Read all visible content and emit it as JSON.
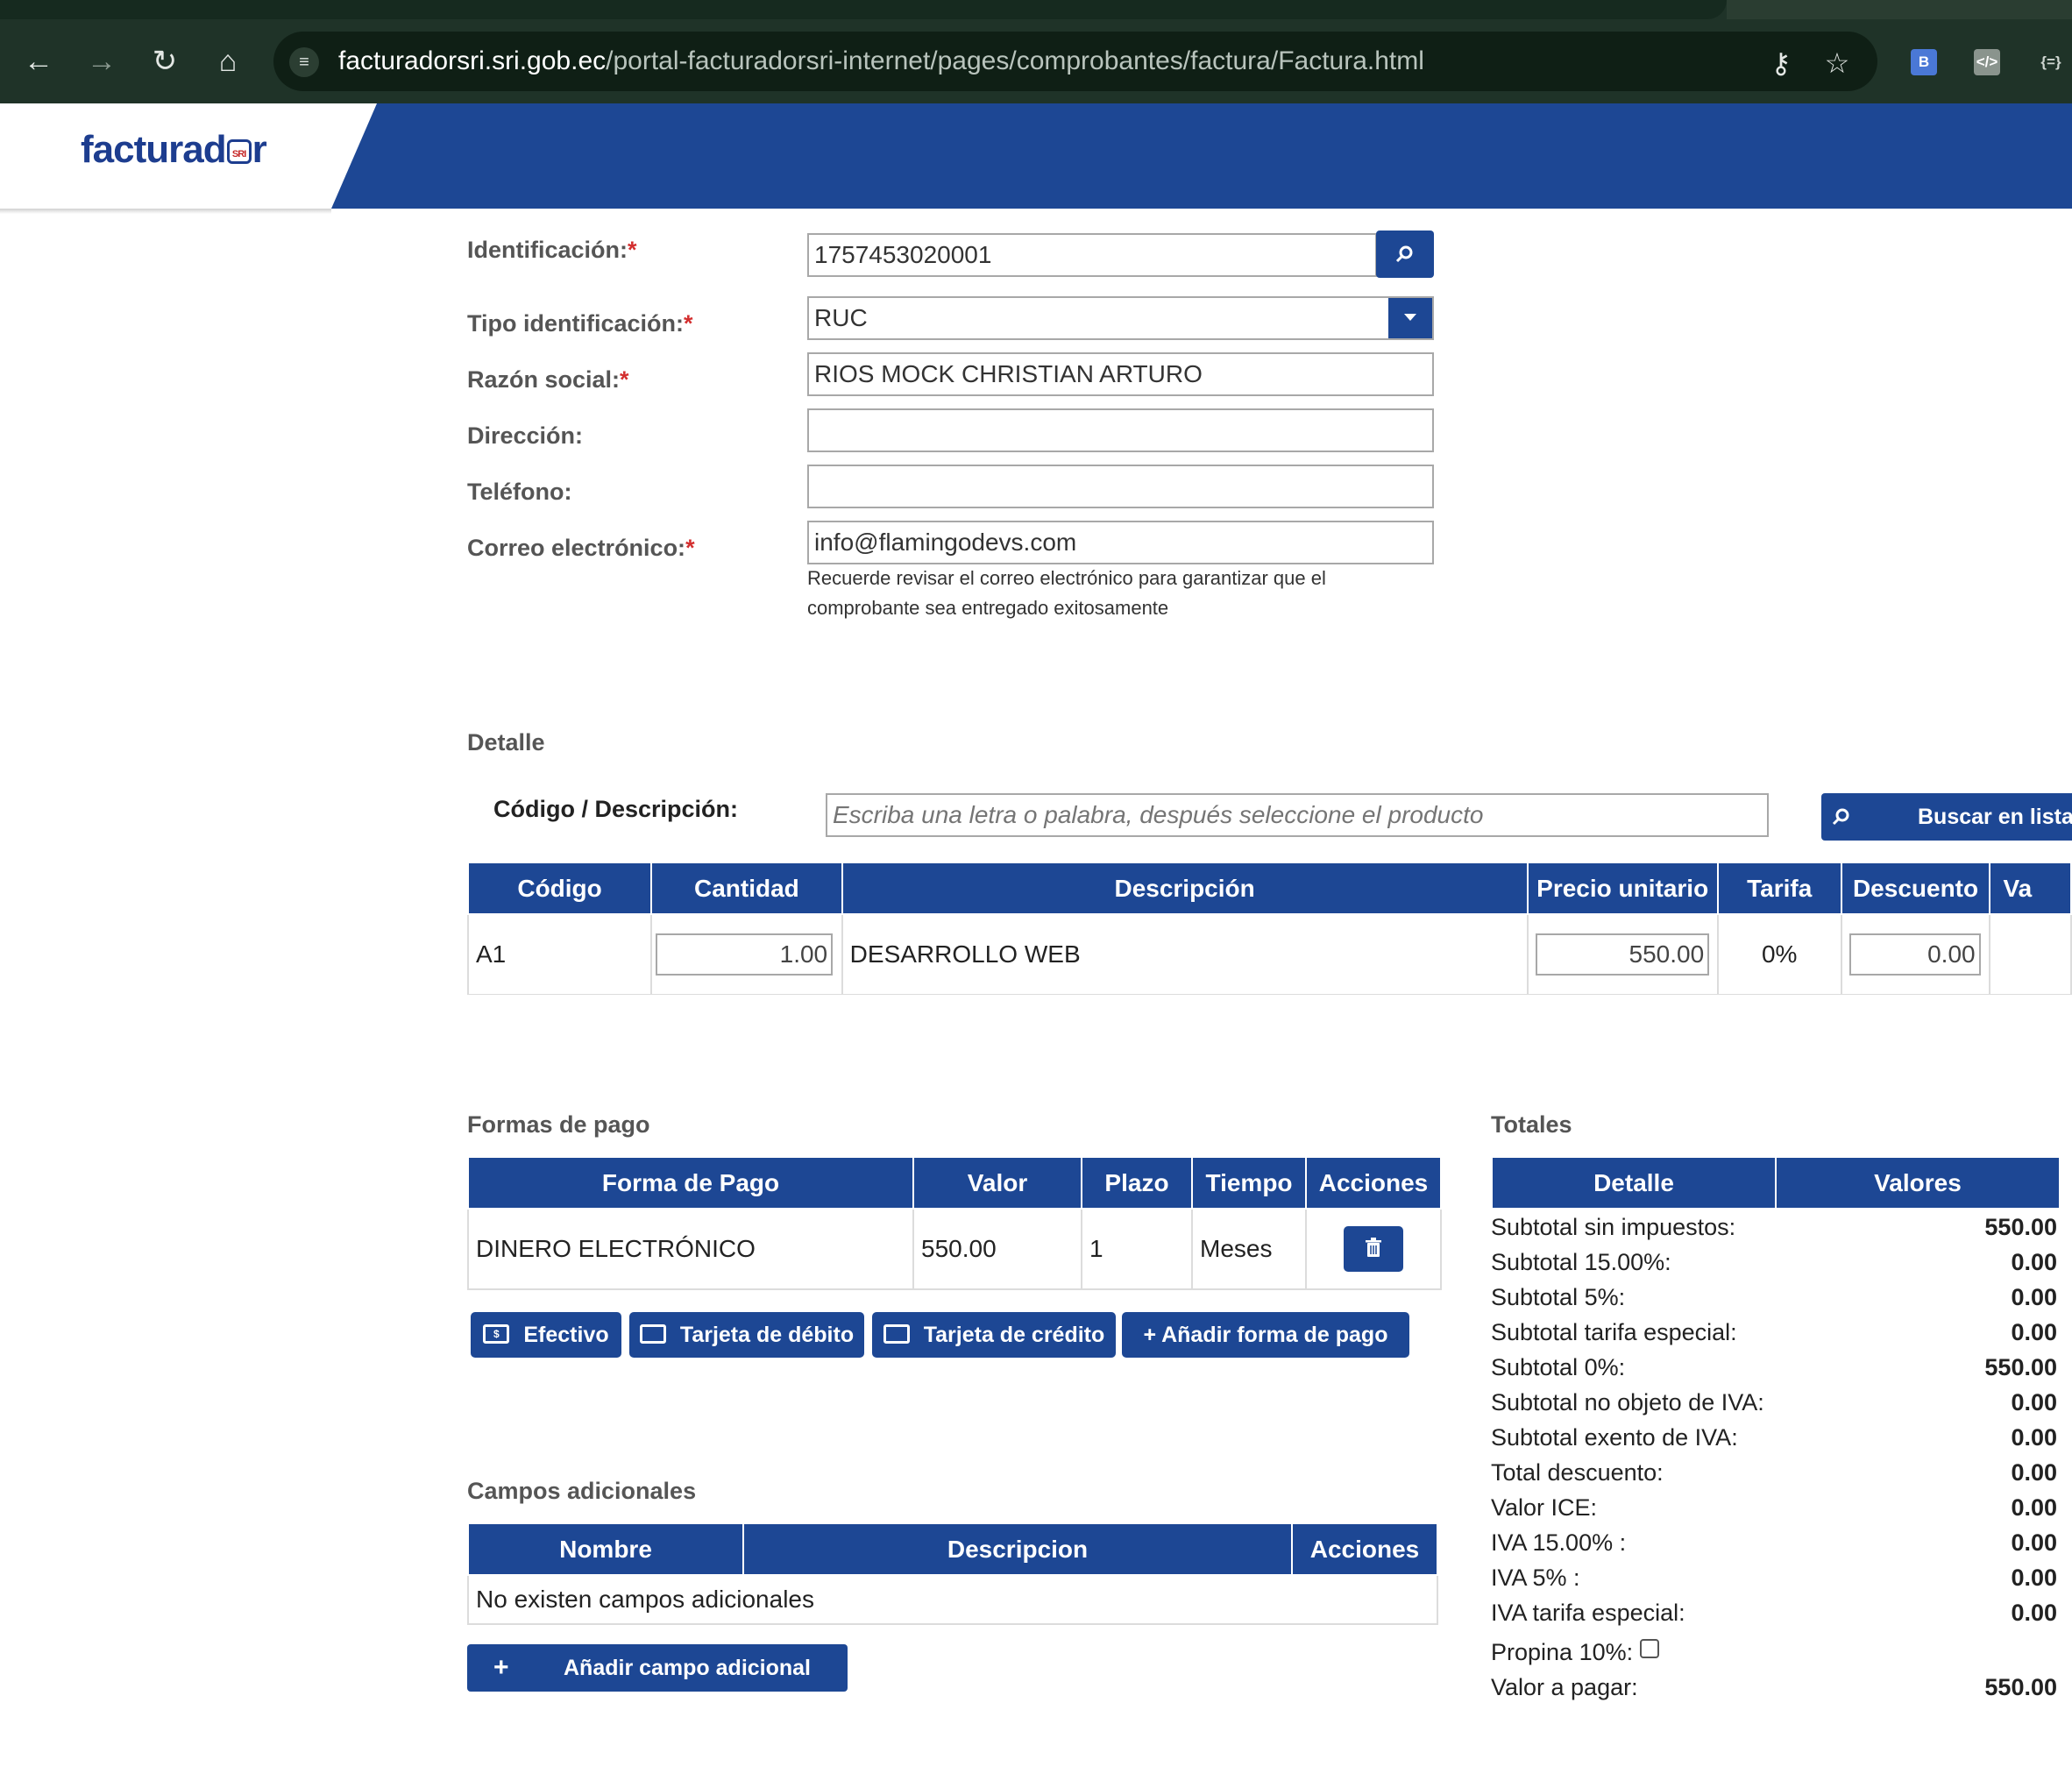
{
  "browser": {
    "url_host": "facturadorsri.sri.gob.ec",
    "url_path": "/portal-facturadorsri-internet/pages/comprobantes/factura/Factura.html",
    "icons": [
      "back-icon",
      "forward-icon",
      "reload-icon",
      "home-icon",
      "site-settings-icon",
      "password-key-icon",
      "bookmark-star-icon",
      "extension-icon"
    ]
  },
  "header": {
    "logo_pre": "facturad",
    "logo_badge": "SRI",
    "logo_post": "r",
    "brand_color": "#1d4794"
  },
  "form": {
    "identificacion_label": "Identificación:",
    "identificacion_value": "1757453020001",
    "tipo_label": "Tipo identificación:",
    "tipo_value": "RUC",
    "razon_label": "Razón social:",
    "razon_value": "RIOS MOCK CHRISTIAN ARTURO",
    "direccion_label": "Dirección:",
    "direccion_value": "",
    "telefono_label": "Teléfono:",
    "telefono_value": "",
    "correo_label": "Correo electrónico:",
    "correo_value": "info@flamingodevs.com",
    "correo_hint_1": "Recuerde revisar el correo electrónico para garantizar que el",
    "correo_hint_2": "comprobante sea entregado exitosamente",
    "required_mark": "*"
  },
  "detalle": {
    "title": "Detalle",
    "codigo_label": "Código / Descripción:",
    "search_placeholder": "Escriba una letra o palabra, después seleccione el producto",
    "search_button": "Buscar en listad",
    "columns": [
      "Código",
      "Cantidad",
      "Descripción",
      "Precio unitario",
      "Tarifa",
      "Descuento",
      "Va"
    ],
    "row": {
      "codigo": "A1",
      "cantidad": "1.00",
      "descripcion": "DESARROLLO WEB",
      "precio": "550.00",
      "tarifa": "0%",
      "descuento": "0.00"
    }
  },
  "pagos": {
    "title": "Formas de pago",
    "columns": [
      "Forma de Pago",
      "Valor",
      "Plazo",
      "Tiempo",
      "Acciones"
    ],
    "row": {
      "forma": "DINERO ELECTRÓNICO",
      "valor": "550.00",
      "plazo": "1",
      "tiempo": "Meses"
    },
    "buttons": {
      "efectivo": "Efectivo",
      "debito": "Tarjeta de débito",
      "credito": "Tarjeta de crédito",
      "anadir": "Añadir forma de pago"
    }
  },
  "adicionales": {
    "title": "Campos adicionales",
    "columns": [
      "Nombre",
      "Descripcion",
      "Acciones"
    ],
    "empty": "No existen campos adicionales",
    "add_button": "Añadir campo adicional"
  },
  "totales": {
    "title": "Totales",
    "columns": [
      "Detalle",
      "Valores"
    ],
    "rows": [
      {
        "label": "Subtotal sin impuestos:",
        "value": "550.00"
      },
      {
        "label": "Subtotal 15.00%:",
        "value": "0.00"
      },
      {
        "label": "Subtotal 5%:",
        "value": "0.00"
      },
      {
        "label": "Subtotal tarifa especial:",
        "value": "0.00"
      },
      {
        "label": "Subtotal 0%:",
        "value": "550.00"
      },
      {
        "label": "Subtotal no objeto de IVA:",
        "value": "0.00"
      },
      {
        "label": "Subtotal exento de IVA:",
        "value": "0.00"
      },
      {
        "label": "Total descuento:",
        "value": "0.00"
      },
      {
        "label": "Valor ICE:",
        "value": "0.00"
      },
      {
        "label": "IVA 15.00% :",
        "value": "0.00"
      },
      {
        "label": "IVA 5% :",
        "value": "0.00"
      },
      {
        "label": "IVA tarifa especial:",
        "value": "0.00"
      }
    ],
    "propina_label": "Propina 10%:",
    "propina_checked": false,
    "valor_pagar_label": "Valor a pagar:",
    "valor_pagar": "550.00"
  }
}
